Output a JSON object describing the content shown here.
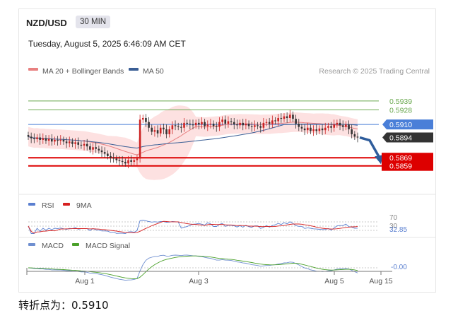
{
  "header": {
    "symbol": "NZD/USD",
    "timeframe": "30 MIN",
    "timestamp": "Tuesday, August 5, 2025 6:46:09 AM CET",
    "copyright": "Research © 2025 Trading Central"
  },
  "caption": {
    "label": "转折点为：",
    "value": "0.5910"
  },
  "colors": {
    "bull": "#cc2222",
    "bear": "#333333",
    "ma20": "#e88080",
    "ma50": "#3a5e95",
    "bollinger_fill": "#fde1e1",
    "support": "#dd0000",
    "resistance_green": "#6aa84f",
    "pivot": "#4a7fd8",
    "rsi": "#5a7fd0",
    "rsi_ma": "#d62020",
    "macd": "#6f8fd0",
    "macd_signal": "#4aa02a",
    "arrow": "#2f5d9c"
  },
  "chart_data": [
    {
      "type": "candlestick",
      "title": "NZD/USD",
      "legend": [
        "MA 20 + Bollinger Bands",
        "MA 50"
      ],
      "legend_position": "top-left",
      "x_ticks": [
        "Aug 1",
        "Aug 3",
        "Aug 5",
        "Aug 15"
      ],
      "ylim": [
        0.583,
        0.5965
      ],
      "levels": [
        {
          "value": 0.5939,
          "label": "0.5939",
          "kind": "resistance",
          "color": "#6aa84f"
        },
        {
          "value": 0.5928,
          "label": "0.5928",
          "kind": "resistance",
          "color": "#6aa84f"
        },
        {
          "value": 0.591,
          "label": "0.5910",
          "kind": "pivot",
          "color": "#4a7fd8"
        },
        {
          "value": 0.5894,
          "label": "0.5894",
          "kind": "last",
          "color": "#333333"
        },
        {
          "value": 0.5869,
          "label": "0.5869",
          "kind": "support",
          "color": "#dd0000"
        },
        {
          "value": 0.5859,
          "label": "0.5859",
          "kind": "support",
          "color": "#dd0000"
        }
      ],
      "forecast_arrow": {
        "from": 0.5894,
        "to": 0.5862
      },
      "close": [
        0.5895,
        0.5893,
        0.5892,
        0.5894,
        0.5891,
        0.5893,
        0.589,
        0.5892,
        0.5889,
        0.5891,
        0.589,
        0.5891,
        0.5889,
        0.5887,
        0.5889,
        0.5886,
        0.5888,
        0.5885,
        0.5884,
        0.5886,
        0.5883,
        0.5879,
        0.5882,
        0.588,
        0.5878,
        0.5876,
        0.5874,
        0.5871,
        0.5869,
        0.5868,
        0.5866,
        0.5865,
        0.5864,
        0.5862,
        0.5866,
        0.5864,
        0.5866,
        0.5868,
        0.5916,
        0.5918,
        0.5913,
        0.5906,
        0.5901,
        0.5903,
        0.5899,
        0.5906,
        0.5904,
        0.5898,
        0.5904,
        0.5909,
        0.5908,
        0.5907,
        0.5906,
        0.5912,
        0.5911,
        0.591,
        0.5909,
        0.5912,
        0.591,
        0.5913,
        0.5908,
        0.591,
        0.5911,
        0.5908,
        0.5907,
        0.5913,
        0.5916,
        0.5911,
        0.5914,
        0.5913,
        0.591,
        0.5909,
        0.5912,
        0.5909,
        0.5911,
        0.5908,
        0.5907,
        0.5909,
        0.5908,
        0.5906,
        0.5912,
        0.5913,
        0.5911,
        0.5915,
        0.5914,
        0.5918,
        0.5917,
        0.592,
        0.5918,
        0.5922,
        0.5917,
        0.5911,
        0.5907,
        0.5905,
        0.5903,
        0.5906,
        0.5902,
        0.5904,
        0.5902,
        0.5905,
        0.5903,
        0.5906,
        0.5908,
        0.5906,
        0.591,
        0.5912,
        0.5909,
        0.5907,
        0.591,
        0.5904,
        0.5898,
        0.5895,
        0.5894
      ]
    },
    {
      "type": "line",
      "title": "RSI",
      "series": [
        {
          "name": "RSI"
        },
        {
          "name": "9MA"
        }
      ],
      "y_levels": [
        "70",
        "30"
      ],
      "last_value": "32.85"
    },
    {
      "type": "line",
      "title": "MACD",
      "series": [
        {
          "name": "MACD"
        },
        {
          "name": "MACD Signal"
        }
      ],
      "last_value": "-0.00"
    }
  ]
}
